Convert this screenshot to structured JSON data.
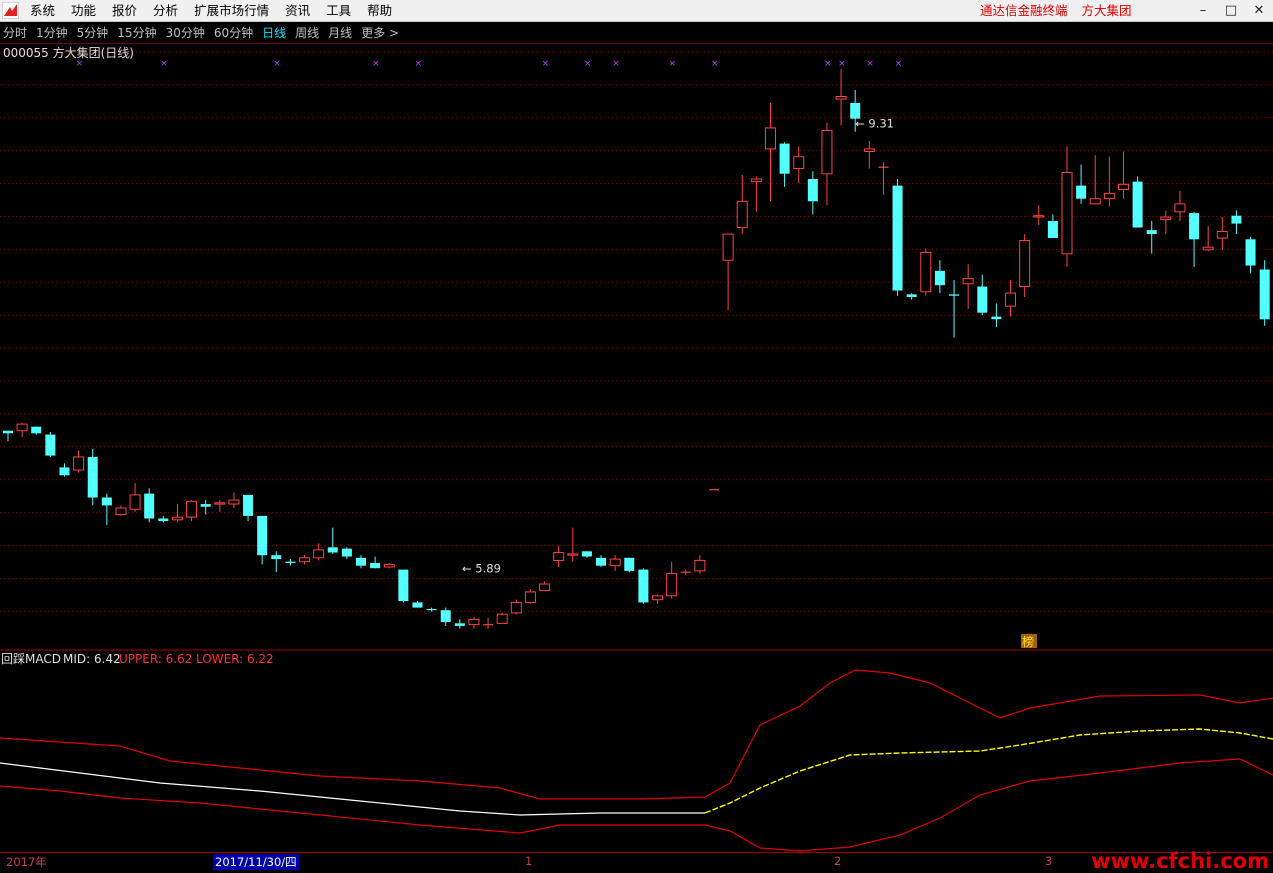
{
  "menubar": {
    "items": [
      "系统",
      "功能",
      "报价",
      "分析",
      "扩展市场行情",
      "资讯",
      "工具",
      "帮助"
    ],
    "title_app": "通达信金融终端",
    "title_stock": "方大集团"
  },
  "period_bar": {
    "items": [
      "分时",
      "1分钟",
      "5分钟",
      "15分钟",
      "30分钟",
      "60分钟",
      "日线",
      "周线",
      "月线",
      "更多 >"
    ],
    "active": "日线"
  },
  "main_chart": {
    "title": "000055 方大集团(日线)",
    "high_label": "9.31",
    "low_label": "5.89",
    "badge": "榜"
  },
  "indicator": {
    "name": "回踩MACD",
    "mid_label": "MID:",
    "mid_value": "6.42",
    "upper_label": "UPPER:",
    "upper_value": "6.62",
    "lower_label": "LOWER:",
    "lower_value": "6.22"
  },
  "date_axis": {
    "labels": [
      "2017年",
      "2017/11/30/四",
      "1",
      "2",
      "3"
    ]
  },
  "watermark": "www.cfchi.com",
  "colors": {
    "up": "#ff4242",
    "down": "#54ffff",
    "upper_band": "#e00000",
    "mid_white": "#ffffff",
    "mid_yellow": "#ffff00",
    "marker": "#c040ff",
    "active_period": "#00e5ff"
  },
  "chart_data": {
    "type": "candlestick",
    "title": "000055 方大集团(日线)",
    "annotations": {
      "high": 9.31,
      "low": 5.89
    },
    "ohlc": [
      [
        6.95,
        6.95,
        6.87,
        6.93
      ],
      [
        6.95,
        7.01,
        6.9,
        7.0
      ],
      [
        6.98,
        6.98,
        6.92,
        6.93
      ],
      [
        6.92,
        6.94,
        6.75,
        6.76
      ],
      [
        6.67,
        6.7,
        6.6,
        6.61
      ],
      [
        6.65,
        6.8,
        6.63,
        6.75
      ],
      [
        6.75,
        6.81,
        6.38,
        6.44
      ],
      [
        6.44,
        6.47,
        6.23,
        6.38
      ],
      [
        6.31,
        6.38,
        6.3,
        6.36
      ],
      [
        6.35,
        6.55,
        6.33,
        6.46
      ],
      [
        6.47,
        6.51,
        6.25,
        6.28
      ],
      [
        6.28,
        6.3,
        6.25,
        6.26
      ],
      [
        6.27,
        6.39,
        6.25,
        6.29
      ],
      [
        6.29,
        6.42,
        6.26,
        6.41
      ],
      [
        6.39,
        6.42,
        6.31,
        6.37
      ],
      [
        6.39,
        6.42,
        6.33,
        6.4
      ],
      [
        6.39,
        6.48,
        6.36,
        6.42
      ],
      [
        6.46,
        6.46,
        6.26,
        6.3
      ],
      [
        6.3,
        6.3,
        5.93,
        6.0
      ],
      [
        6.0,
        6.03,
        5.87,
        5.97
      ],
      [
        5.95,
        5.97,
        5.92,
        5.94
      ],
      [
        5.95,
        6.0,
        5.93,
        5.98
      ],
      [
        5.98,
        6.09,
        5.96,
        6.04
      ],
      [
        6.06,
        6.21,
        6.01,
        6.02
      ],
      [
        6.05,
        6.06,
        5.97,
        5.99
      ],
      [
        5.98,
        6.0,
        5.9,
        5.92
      ],
      [
        5.94,
        5.99,
        5.9,
        5.9
      ],
      [
        5.91,
        5.94,
        5.9,
        5.93
      ],
      [
        5.89,
        5.84,
        5.64,
        5.65
      ],
      [
        5.64,
        5.65,
        5.6,
        5.6
      ],
      [
        5.59,
        5.6,
        5.57,
        5.58
      ],
      [
        5.58,
        5.6,
        5.46,
        5.49
      ],
      [
        5.48,
        5.51,
        5.44,
        5.46
      ],
      [
        5.47,
        5.53,
        5.44,
        5.51
      ],
      [
        5.47,
        5.52,
        5.44,
        5.47
      ],
      [
        5.48,
        5.56,
        5.48,
        5.55
      ],
      [
        5.56,
        5.66,
        5.55,
        5.64
      ],
      [
        5.64,
        5.74,
        5.63,
        5.72
      ],
      [
        5.73,
        5.8,
        5.73,
        5.78
      ],
      [
        5.96,
        6.07,
        5.91,
        6.02
      ],
      [
        6.0,
        6.21,
        5.95,
        6.01
      ],
      [
        6.03,
        6.03,
        5.98,
        5.99
      ],
      [
        5.98,
        6.0,
        5.91,
        5.92
      ],
      [
        5.92,
        6.0,
        5.88,
        5.97
      ],
      [
        5.98,
        5.98,
        5.87,
        5.88
      ],
      [
        5.89,
        5.9,
        5.63,
        5.64
      ],
      [
        5.66,
        5.7,
        5.63,
        5.69
      ],
      [
        5.69,
        5.95,
        5.67,
        5.86
      ],
      [
        5.87,
        5.89,
        5.85,
        5.87
      ],
      [
        5.88,
        6.0,
        5.86,
        5.96
      ],
      [
        6.5,
        6.5,
        6.5,
        6.5
      ],
      [
        8.25,
        8.45,
        7.87,
        8.45
      ],
      [
        8.5,
        8.9,
        8.45,
        8.7
      ],
      [
        8.85,
        8.89,
        8.62,
        8.87
      ],
      [
        9.1,
        9.45,
        8.7,
        9.26
      ],
      [
        9.14,
        9.15,
        8.81,
        8.91
      ],
      [
        8.95,
        9.12,
        8.84,
        9.04
      ],
      [
        8.87,
        8.93,
        8.6,
        8.7
      ],
      [
        8.91,
        9.3,
        8.67,
        9.24
      ],
      [
        9.48,
        9.71,
        9.28,
        9.5
      ],
      [
        9.45,
        9.55,
        9.23,
        9.33
      ],
      [
        9.08,
        9.16,
        8.95,
        9.1
      ],
      [
        8.96,
        9.0,
        8.75,
        8.96
      ],
      [
        8.82,
        8.87,
        7.98,
        8.02
      ],
      [
        7.99,
        8.0,
        7.95,
        7.97
      ],
      [
        8.01,
        8.34,
        7.98,
        8.31
      ],
      [
        8.17,
        8.25,
        8.0,
        8.06
      ],
      [
        7.99,
        8.1,
        7.66,
        7.98
      ],
      [
        8.07,
        8.22,
        7.88,
        8.11
      ],
      [
        8.05,
        8.14,
        7.83,
        7.85
      ],
      [
        7.82,
        7.92,
        7.74,
        7.8
      ],
      [
        7.9,
        8.1,
        7.82,
        8.0
      ],
      [
        8.05,
        8.45,
        7.97,
        8.4
      ],
      [
        8.58,
        8.67,
        8.52,
        8.59
      ],
      [
        8.55,
        8.6,
        8.42,
        8.42
      ],
      [
        8.3,
        9.12,
        8.2,
        8.92
      ],
      [
        8.82,
        8.98,
        8.68,
        8.72
      ],
      [
        8.68,
        9.05,
        8.7,
        8.72
      ],
      [
        8.72,
        9.04,
        8.66,
        8.76
      ],
      [
        8.79,
        9.08,
        8.72,
        8.83
      ],
      [
        8.85,
        8.89,
        8.5,
        8.5
      ],
      [
        8.48,
        8.55,
        8.3,
        8.45
      ],
      [
        8.56,
        8.63,
        8.45,
        8.58
      ],
      [
        8.62,
        8.78,
        8.55,
        8.68
      ],
      [
        8.61,
        8.62,
        8.2,
        8.41
      ],
      [
        8.33,
        8.51,
        8.32,
        8.35
      ],
      [
        8.42,
        8.58,
        8.33,
        8.47
      ],
      [
        8.59,
        8.63,
        8.45,
        8.53
      ],
      [
        8.41,
        8.43,
        8.15,
        8.21
      ],
      [
        8.18,
        8.25,
        7.75,
        7.8
      ],
      [
        7.77,
        8.0,
        7.52,
        7.58
      ],
      [
        7.68,
        8.0,
        7.62,
        7.95
      ],
      [
        7.72,
        7.76,
        7.2,
        7.21
      ]
    ],
    "marker_candles": [
      5,
      11,
      19,
      26,
      29,
      38,
      41,
      43,
      47,
      50,
      58,
      59,
      61,
      63
    ],
    "indicator": {
      "name": "回踩MACD",
      "mid": 6.42,
      "upper": 6.62,
      "lower": 6.22
    }
  }
}
